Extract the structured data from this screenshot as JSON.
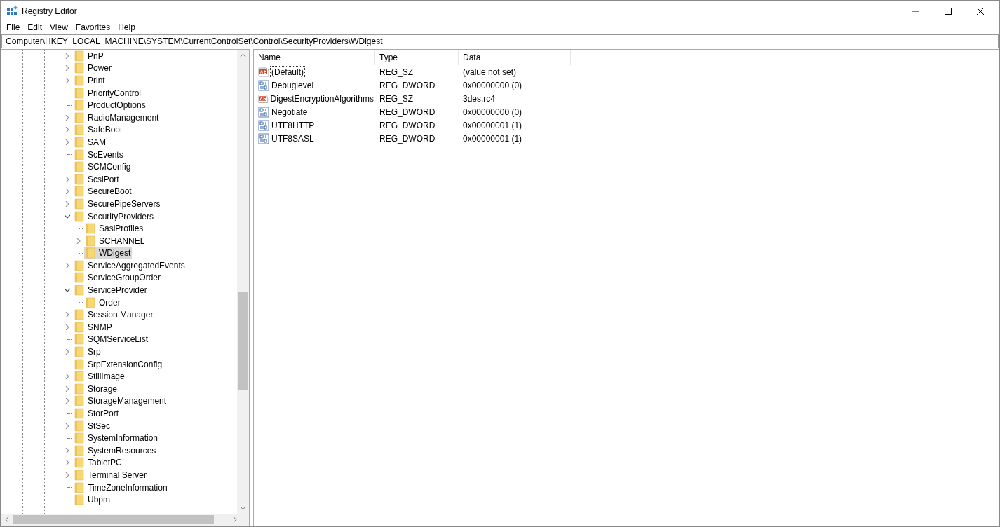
{
  "window": {
    "title": "Registry Editor"
  },
  "menu": [
    "File",
    "Edit",
    "View",
    "Favorites",
    "Help"
  ],
  "address": "Computer\\HKEY_LOCAL_MACHINE\\SYSTEM\\CurrentControlSet\\Control\\SecurityProviders\\WDigest",
  "tree": [
    {
      "label": "PnP",
      "kind": "branch",
      "expanded": false,
      "selected": false
    },
    {
      "label": "Power",
      "kind": "branch",
      "expanded": false,
      "selected": false
    },
    {
      "label": "Print",
      "kind": "branch",
      "expanded": false,
      "selected": false
    },
    {
      "label": "PriorityControl",
      "kind": "leaf",
      "selected": false
    },
    {
      "label": "ProductOptions",
      "kind": "leaf",
      "selected": false
    },
    {
      "label": "RadioManagement",
      "kind": "branch",
      "expanded": false,
      "selected": false
    },
    {
      "label": "SafeBoot",
      "kind": "branch",
      "expanded": false,
      "selected": false
    },
    {
      "label": "SAM",
      "kind": "branch",
      "expanded": false,
      "selected": false
    },
    {
      "label": "ScEvents",
      "kind": "leaf",
      "selected": false
    },
    {
      "label": "SCMConfig",
      "kind": "leaf",
      "selected": false
    },
    {
      "label": "ScsiPort",
      "kind": "branch",
      "expanded": false,
      "selected": false
    },
    {
      "label": "SecureBoot",
      "kind": "branch",
      "expanded": false,
      "selected": false
    },
    {
      "label": "SecurePipeServers",
      "kind": "branch",
      "expanded": false,
      "selected": false
    },
    {
      "label": "SecurityProviders",
      "kind": "branch",
      "expanded": true,
      "selected": false,
      "children": [
        {
          "label": "SaslProfiles",
          "kind": "leaf",
          "selected": false
        },
        {
          "label": "SCHANNEL",
          "kind": "branch",
          "expanded": false,
          "selected": false
        },
        {
          "label": "WDigest",
          "kind": "leaf",
          "selected": true
        }
      ]
    },
    {
      "label": "ServiceAggregatedEvents",
      "kind": "branch",
      "expanded": false,
      "selected": false
    },
    {
      "label": "ServiceGroupOrder",
      "kind": "leaf",
      "selected": false
    },
    {
      "label": "ServiceProvider",
      "kind": "branch",
      "expanded": true,
      "selected": false,
      "children": [
        {
          "label": "Order",
          "kind": "leaf",
          "selected": false
        }
      ]
    },
    {
      "label": "Session Manager",
      "kind": "branch",
      "expanded": false,
      "selected": false
    },
    {
      "label": "SNMP",
      "kind": "branch",
      "expanded": false,
      "selected": false
    },
    {
      "label": "SQMServiceList",
      "kind": "leaf",
      "selected": false
    },
    {
      "label": "Srp",
      "kind": "branch",
      "expanded": false,
      "selected": false
    },
    {
      "label": "SrpExtensionConfig",
      "kind": "leaf",
      "selected": false
    },
    {
      "label": "StillImage",
      "kind": "branch",
      "expanded": false,
      "selected": false
    },
    {
      "label": "Storage",
      "kind": "branch",
      "expanded": false,
      "selected": false
    },
    {
      "label": "StorageManagement",
      "kind": "branch",
      "expanded": false,
      "selected": false
    },
    {
      "label": "StorPort",
      "kind": "leaf",
      "selected": false
    },
    {
      "label": "StSec",
      "kind": "branch",
      "expanded": false,
      "selected": false
    },
    {
      "label": "SystemInformation",
      "kind": "leaf",
      "selected": false
    },
    {
      "label": "SystemResources",
      "kind": "branch",
      "expanded": false,
      "selected": false
    },
    {
      "label": "TabletPC",
      "kind": "branch",
      "expanded": false,
      "selected": false
    },
    {
      "label": "Terminal Server",
      "kind": "branch",
      "expanded": false,
      "selected": false
    },
    {
      "label": "TimeZoneInformation",
      "kind": "leaf",
      "selected": false
    },
    {
      "label": "Ubpm",
      "kind": "leaf",
      "selected": false
    }
  ],
  "values": {
    "columns": [
      "Name",
      "Type",
      "Data"
    ],
    "rows": [
      {
        "kind": "string",
        "name": "(Default)",
        "type": "REG_SZ",
        "data": "(value not set)",
        "focused": true
      },
      {
        "kind": "dword",
        "name": "Debuglevel",
        "type": "REG_DWORD",
        "data": "0x00000000 (0)",
        "focused": false
      },
      {
        "kind": "string",
        "name": "DigestEncryptionAlgorithms",
        "type": "REG_SZ",
        "data": "3des,rc4",
        "focused": false
      },
      {
        "kind": "dword",
        "name": "Negotiate",
        "type": "REG_DWORD",
        "data": "0x00000000 (0)",
        "focused": false
      },
      {
        "kind": "dword",
        "name": "UTF8HTTP",
        "type": "REG_DWORD",
        "data": "0x00000001 (1)",
        "focused": false
      },
      {
        "kind": "dword",
        "name": "UTF8SASL",
        "type": "REG_DWORD",
        "data": "0x00000001 (1)",
        "focused": false
      }
    ]
  }
}
